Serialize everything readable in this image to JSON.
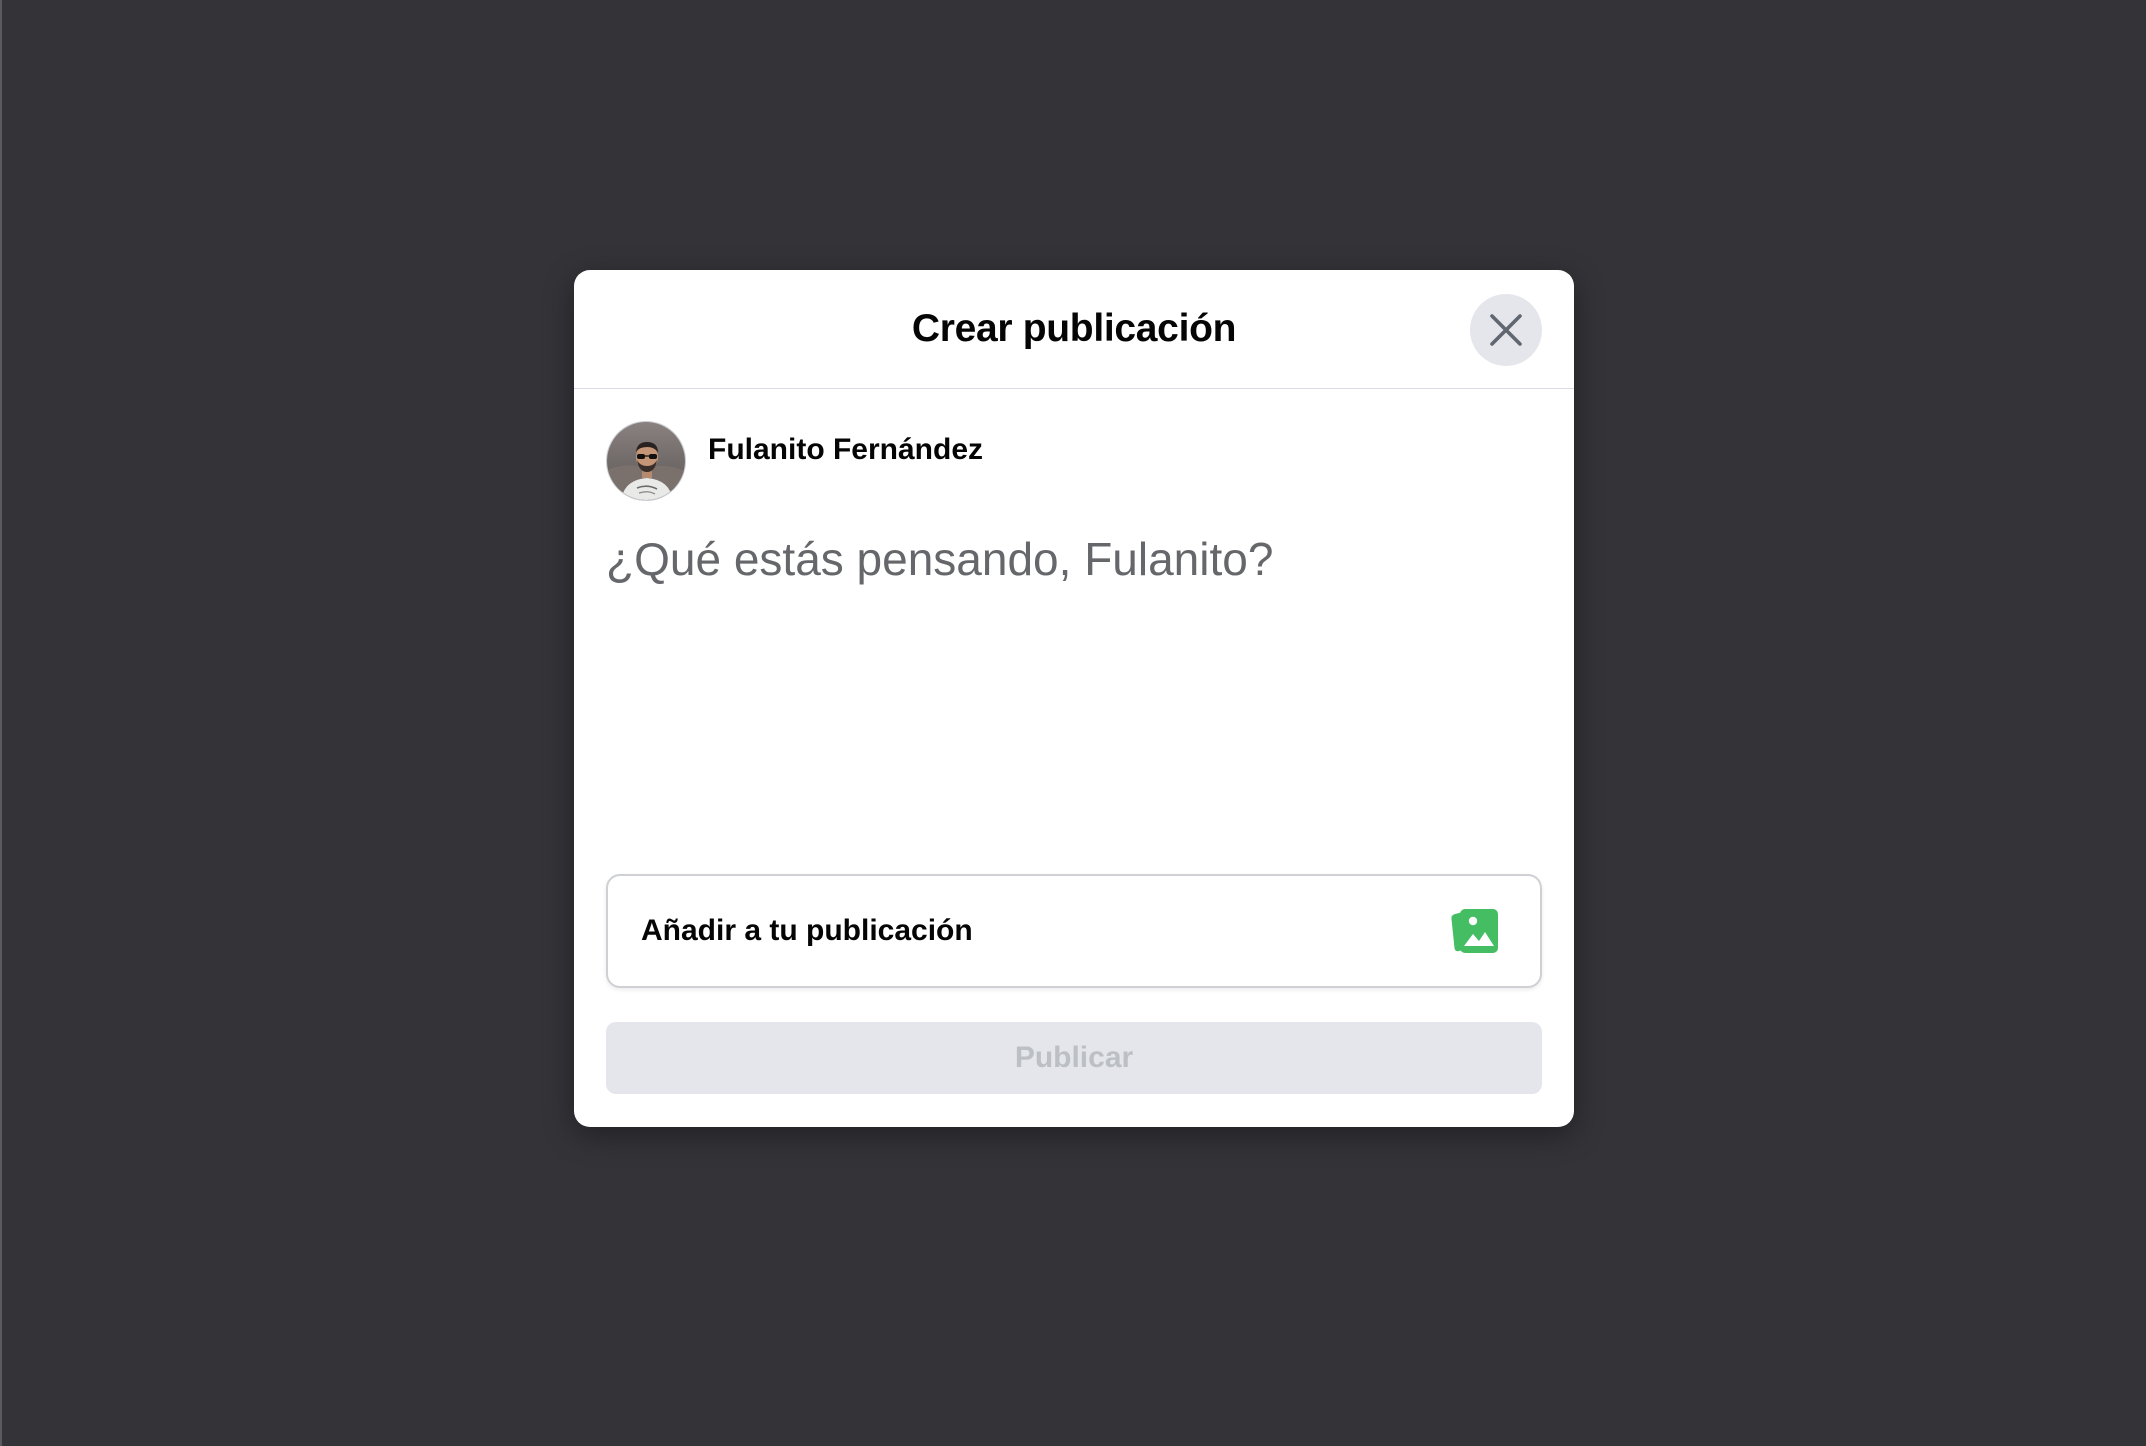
{
  "modal": {
    "title": "Crear publicación",
    "close_icon": "close-icon"
  },
  "author": {
    "name": "Fulanito Fernández",
    "avatar_icon": "user-avatar-photo"
  },
  "composer": {
    "placeholder": "¿Qué estás pensando, Fulanito?",
    "value": ""
  },
  "add_to_post": {
    "label": "Añadir a tu publicación",
    "photo_icon": "photo-video-icon",
    "photo_icon_color": "#45bd62"
  },
  "publish": {
    "label": "Publicar",
    "enabled": false
  },
  "colors": {
    "backdrop": "#333338",
    "modal_bg": "#ffffff",
    "disabled_button_bg": "#e4e6eb",
    "disabled_button_text": "#bcc0c4",
    "placeholder_text": "#65676b"
  }
}
